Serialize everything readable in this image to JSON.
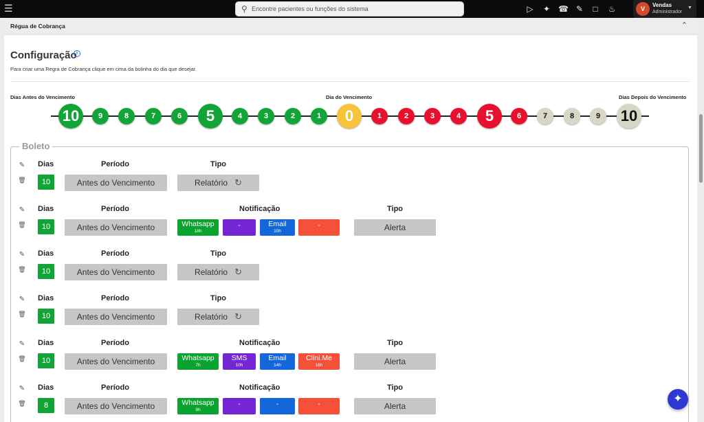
{
  "topbar": {
    "search_placeholder": "Encontre pacientes ou funções do sistema",
    "user": {
      "initial": "V",
      "name": "Vendas",
      "role": "Administrador"
    },
    "icons": [
      "menu-icon",
      "search-icon",
      "video-icon",
      "ai-spark-icon",
      "headset-icon",
      "notes-icon",
      "chat-icon",
      "bell-icon",
      "chevron-down-icon"
    ]
  },
  "panel": {
    "title": "Régua de Cobrança",
    "config_title": "Configuração",
    "description": "Para criar uma Regra de Cobrança clique em cima da bolinha do dia que desejar.",
    "label_before": "Dias Antes do Vencimento",
    "label_due": "Dia do Vencimento",
    "label_after": "Dias Depois do Vencimento"
  },
  "timeline": {
    "colors": {
      "before": "#13a437",
      "due": "#f6c33b",
      "after_red": "#e8112d",
      "after_grey": "#d8d7c6"
    },
    "dots": [
      {
        "label": "10",
        "color": "green",
        "big": true
      },
      {
        "label": "9",
        "color": "green",
        "big": false
      },
      {
        "label": "8",
        "color": "green",
        "big": false
      },
      {
        "label": "7",
        "color": "green",
        "big": false
      },
      {
        "label": "6",
        "color": "green",
        "big": false
      },
      {
        "label": "5",
        "color": "green",
        "big": true
      },
      {
        "label": "4",
        "color": "green",
        "big": false
      },
      {
        "label": "3",
        "color": "green",
        "big": false
      },
      {
        "label": "2",
        "color": "green",
        "big": false
      },
      {
        "label": "1",
        "color": "green",
        "big": false
      },
      {
        "label": "0",
        "color": "yellow",
        "big": true
      },
      {
        "label": "1",
        "color": "red",
        "big": false
      },
      {
        "label": "2",
        "color": "red",
        "big": false
      },
      {
        "label": "3",
        "color": "red",
        "big": false
      },
      {
        "label": "4",
        "color": "red",
        "big": false
      },
      {
        "label": "5",
        "color": "red",
        "big": true
      },
      {
        "label": "6",
        "color": "red",
        "big": false
      },
      {
        "label": "7",
        "color": "grey",
        "big": false
      },
      {
        "label": "8",
        "color": "grey",
        "big": false
      },
      {
        "label": "9",
        "color": "grey",
        "big": false
      },
      {
        "label": "10",
        "color": "grey",
        "big": true
      }
    ]
  },
  "boleto": {
    "title": "Boleto",
    "headers": {
      "dias": "Dias",
      "periodo": "Período",
      "tipo": "Tipo",
      "notificacao": "Notificação"
    },
    "rules": [
      {
        "dias": "10",
        "periodo": "Antes do Vencimento",
        "tipo": "Relatório",
        "notifications": null
      },
      {
        "dias": "10",
        "periodo": "Antes do Vencimento",
        "tipo": "Alerta",
        "notifications": [
          {
            "label": "Whatsapp",
            "time": "18h",
            "kind": "wa"
          },
          {
            "label": "-",
            "time": "",
            "kind": "sms"
          },
          {
            "label": "Email",
            "time": "10h",
            "kind": "email"
          },
          {
            "label": "-",
            "time": "",
            "kind": "clini"
          }
        ]
      },
      {
        "dias": "10",
        "periodo": "Antes do Vencimento",
        "tipo": "Relatório",
        "notifications": null
      },
      {
        "dias": "10",
        "periodo": "Antes do Vencimento",
        "tipo": "Relatório",
        "notifications": null
      },
      {
        "dias": "10",
        "periodo": "Antes do Vencimento",
        "tipo": "Alerta",
        "notifications": [
          {
            "label": "Whatsapp",
            "time": "7h",
            "kind": "wa"
          },
          {
            "label": "SMS",
            "time": "10h",
            "kind": "sms"
          },
          {
            "label": "Email",
            "time": "14h",
            "kind": "email"
          },
          {
            "label": "Clini.Me",
            "time": "16h",
            "kind": "clini"
          }
        ]
      },
      {
        "dias": "8",
        "periodo": "Antes do Vencimento",
        "tipo": "Alerta",
        "notifications": [
          {
            "label": "Whatsapp",
            "time": "9h",
            "kind": "wa"
          },
          {
            "label": "-",
            "time": "",
            "kind": "sms"
          },
          {
            "label": "-",
            "time": "",
            "kind": "email"
          },
          {
            "label": "-",
            "time": "",
            "kind": "clini"
          }
        ]
      }
    ]
  }
}
